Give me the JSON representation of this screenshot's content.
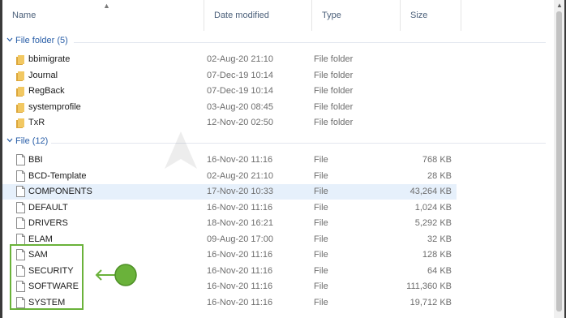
{
  "columns": {
    "name": "Name",
    "date_modified": "Date modified",
    "type": "Type",
    "size": "Size"
  },
  "groups": {
    "folders_label": "File folder (5)",
    "files_label": "File (12)"
  },
  "folders": [
    {
      "name": "bbimigrate",
      "date": "02-Aug-20 21:10",
      "type": "File folder",
      "size": ""
    },
    {
      "name": "Journal",
      "date": "07-Dec-19 10:14",
      "type": "File folder",
      "size": ""
    },
    {
      "name": "RegBack",
      "date": "07-Dec-19 10:14",
      "type": "File folder",
      "size": ""
    },
    {
      "name": "systemprofile",
      "date": "03-Aug-20 08:45",
      "type": "File folder",
      "size": ""
    },
    {
      "name": "TxR",
      "date": "12-Nov-20 02:50",
      "type": "File folder",
      "size": ""
    }
  ],
  "files": [
    {
      "name": "BBI",
      "date": "16-Nov-20 11:16",
      "type": "File",
      "size": "768 KB"
    },
    {
      "name": "BCD-Template",
      "date": "02-Aug-20 21:10",
      "type": "File",
      "size": "28 KB"
    },
    {
      "name": "COMPONENTS",
      "date": "17-Nov-20 10:33",
      "type": "File",
      "size": "43,264 KB"
    },
    {
      "name": "DEFAULT",
      "date": "16-Nov-20 11:16",
      "type": "File",
      "size": "1,024 KB"
    },
    {
      "name": "DRIVERS",
      "date": "18-Nov-20 16:21",
      "type": "File",
      "size": "5,292 KB"
    },
    {
      "name": "ELAM",
      "date": "09-Aug-20 17:00",
      "type": "File",
      "size": "32 KB"
    },
    {
      "name": "SAM",
      "date": "16-Nov-20 11:16",
      "type": "File",
      "size": "128 KB"
    },
    {
      "name": "SECURITY",
      "date": "16-Nov-20 11:16",
      "type": "File",
      "size": "64 KB"
    },
    {
      "name": "SOFTWARE",
      "date": "16-Nov-20 11:16",
      "type": "File",
      "size": "111,360 KB"
    },
    {
      "name": "SYSTEM",
      "date": "16-Nov-20 11:16",
      "type": "File",
      "size": "19,712 KB"
    }
  ],
  "colors": {
    "group_label": "#2a5fa8",
    "folder_icon": "#e8b84a",
    "selected_row": "#e6f0fb",
    "annotation": "#6ab23a"
  },
  "icons": {
    "sort": "sort-up-icon",
    "group": "chevron-down-icon",
    "folder": "folder-icon",
    "file": "file-icon",
    "annotation": "pointer-arrow-icon"
  }
}
